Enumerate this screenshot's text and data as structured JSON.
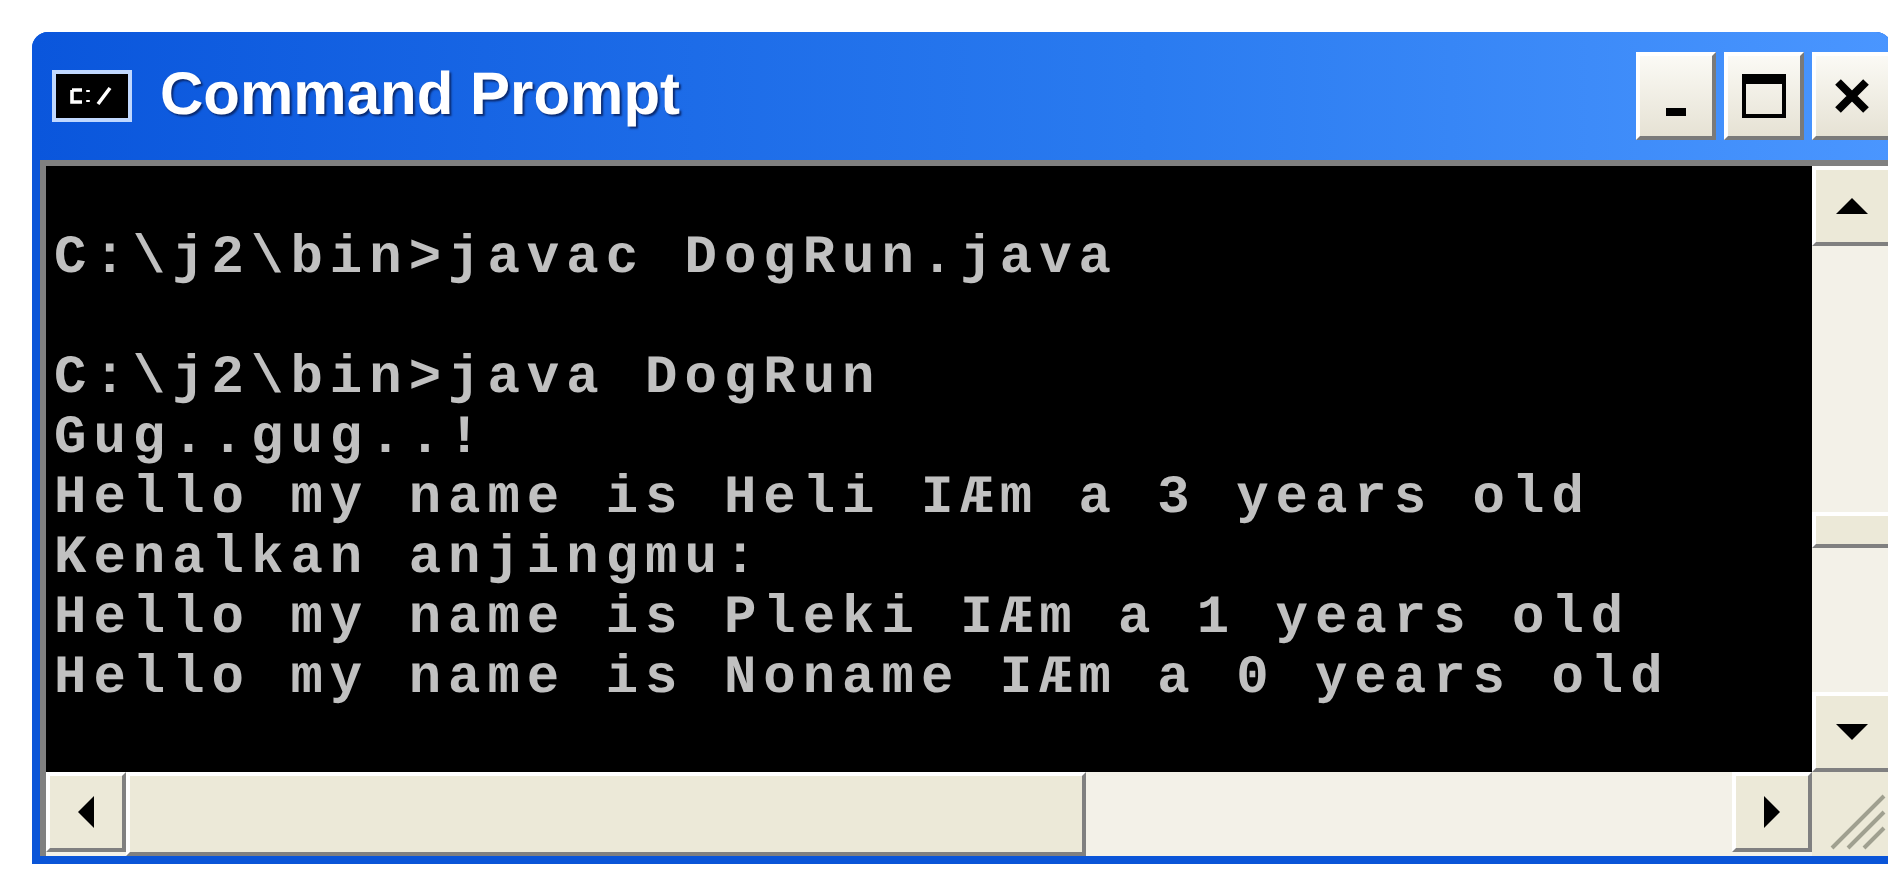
{
  "window": {
    "title": "Command Prompt"
  },
  "console": {
    "blocks": [
      {
        "prompt": "C:\\j2\\bin>",
        "command": "javac DogRun.java"
      },
      {
        "prompt": "C:\\j2\\bin>",
        "command": "java DogRun",
        "output": [
          "Gug..gug..!",
          "Hello my name is Heli IÆm a 3 years old",
          "Kenalkan anjingmu:",
          "Hello my name is Pleki IÆm a 1 years old",
          "Hello my name is Noname IÆm a 0 years old"
        ]
      }
    ]
  }
}
